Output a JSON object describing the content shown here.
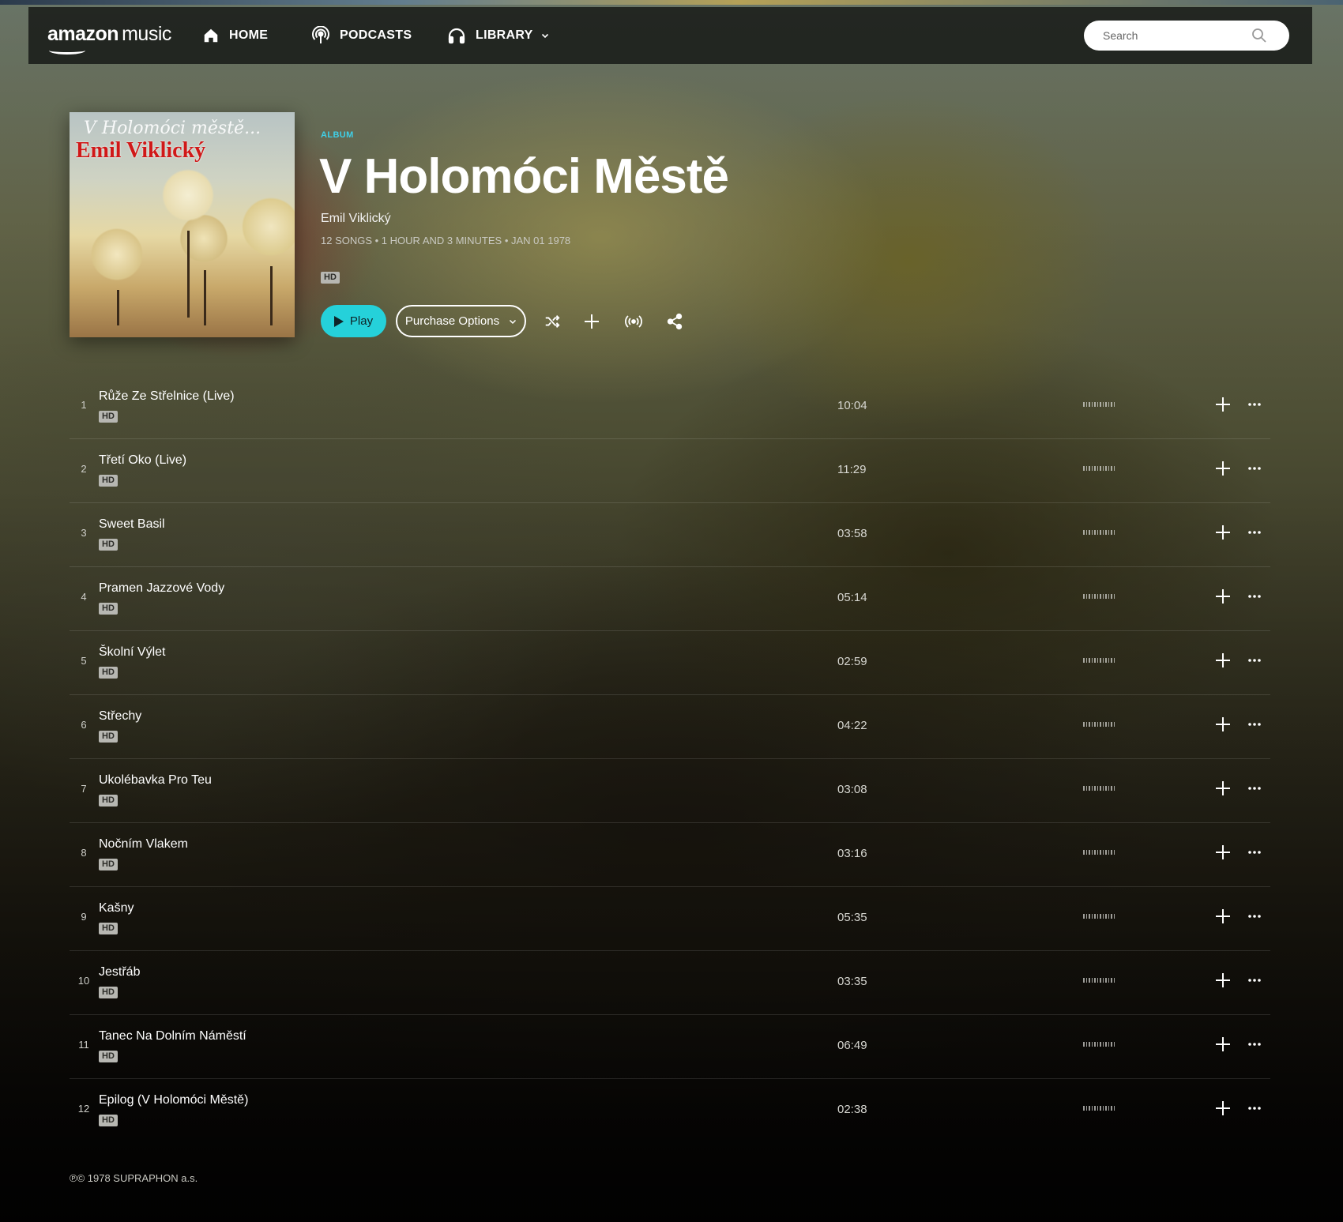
{
  "nav": {
    "logo_bold": "amazon",
    "logo_light": "music",
    "home": "HOME",
    "podcasts": "PODCASTS",
    "library": "LIBRARY",
    "search_placeholder": "Search"
  },
  "album": {
    "label": "ALBUM",
    "title": "V Holomóci Městě",
    "artist": "Emil Viklický",
    "meta": "12 SONGS • 1 HOUR AND 3 MINUTES • JAN 01 1978",
    "quality": "HD",
    "cover_line1": "V Holomóci městě...",
    "cover_line2": "Emil Viklický"
  },
  "actions": {
    "play": "Play",
    "purchase": "Purchase Options"
  },
  "tracks": [
    {
      "num": "1",
      "title": "Růže Ze Střelnice (Live)",
      "quality": "HD",
      "duration": "10:04"
    },
    {
      "num": "2",
      "title": "Třetí Oko (Live)",
      "quality": "HD",
      "duration": "11:29"
    },
    {
      "num": "3",
      "title": "Sweet Basil",
      "quality": "HD",
      "duration": "03:58"
    },
    {
      "num": "4",
      "title": "Pramen Jazzové Vody",
      "quality": "HD",
      "duration": "05:14"
    },
    {
      "num": "5",
      "title": "Školní Výlet",
      "quality": "HD",
      "duration": "02:59"
    },
    {
      "num": "6",
      "title": "Střechy",
      "quality": "HD",
      "duration": "04:22"
    },
    {
      "num": "7",
      "title": "Ukolébavka Pro Teu",
      "quality": "HD",
      "duration": "03:08"
    },
    {
      "num": "8",
      "title": "Nočním Vlakem",
      "quality": "HD",
      "duration": "03:16"
    },
    {
      "num": "9",
      "title": "Kašny",
      "quality": "HD",
      "duration": "05:35"
    },
    {
      "num": "10",
      "title": "Jestřáb",
      "quality": "HD",
      "duration": "03:35"
    },
    {
      "num": "11",
      "title": "Tanec Na Dolním Náměstí",
      "quality": "HD",
      "duration": "06:49"
    },
    {
      "num": "12",
      "title": "Epilog (V Holomóci Městě)",
      "quality": "HD",
      "duration": "02:38"
    }
  ],
  "footer": "℗© 1978 SUPRAPHON a.s.",
  "colors": {
    "accent": "#25d1da",
    "album_label": "#3fd0e8",
    "hd_badge": "#b7b7b2"
  }
}
